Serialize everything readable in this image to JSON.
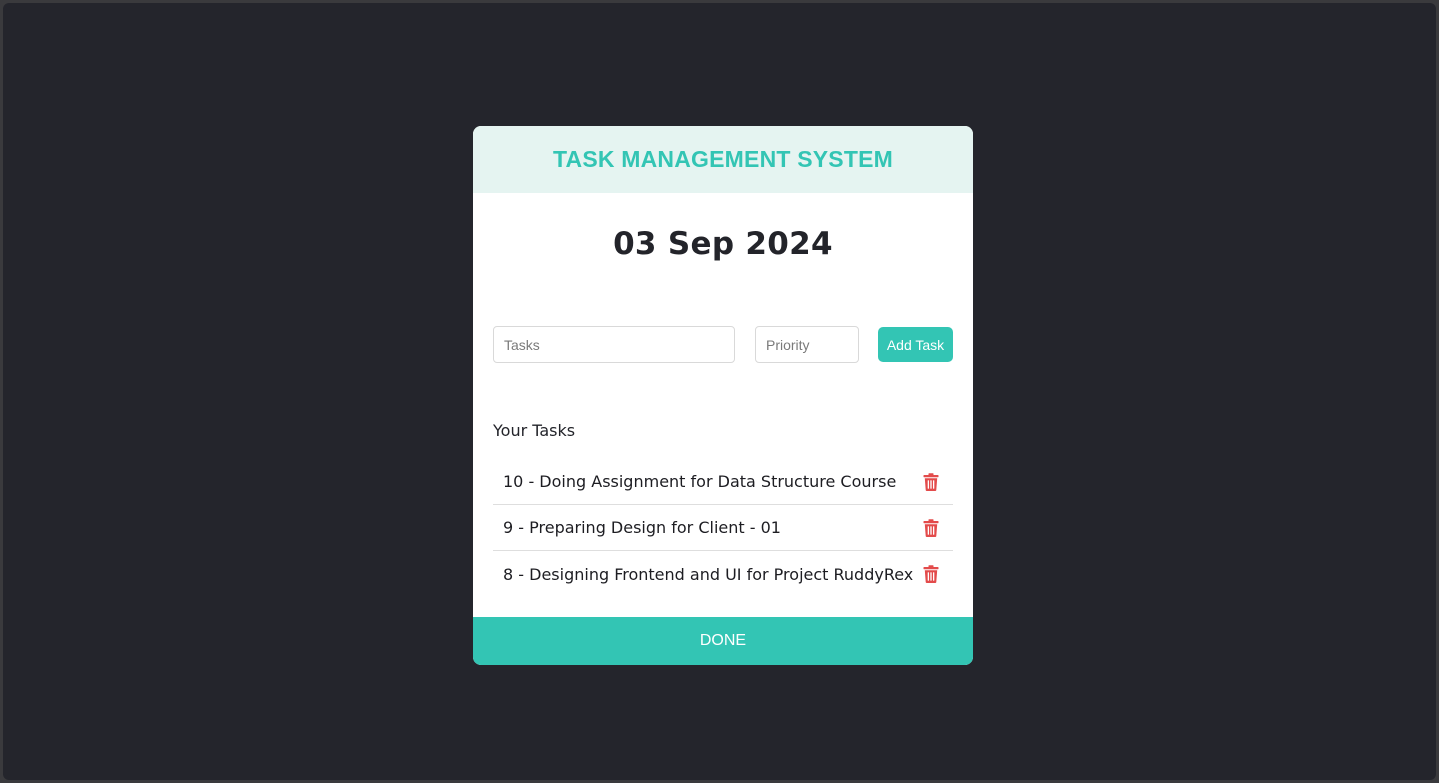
{
  "header": {
    "title": "TASK MANAGEMENT SYSTEM"
  },
  "date": "03 Sep 2024",
  "form": {
    "task_placeholder": "Tasks",
    "priority_placeholder": "Priority",
    "add_label": "Add Task"
  },
  "tasks_section": {
    "label": "Your Tasks",
    "items": [
      {
        "text": "10 - Doing Assignment for Data Structure Course",
        "icon": "trash-icon"
      },
      {
        "text": "9 - Preparing Design for Client - 01",
        "icon": "trash-icon"
      },
      {
        "text": "8 - Designing Frontend and UI for Project RuddyRex",
        "icon": "trash-icon"
      }
    ]
  },
  "footer": {
    "done_label": "DONE"
  },
  "colors": {
    "accent": "#33c5b4",
    "header_bg": "#e5f4f1",
    "delete": "#e34b4b",
    "page_bg": "#24252c"
  }
}
